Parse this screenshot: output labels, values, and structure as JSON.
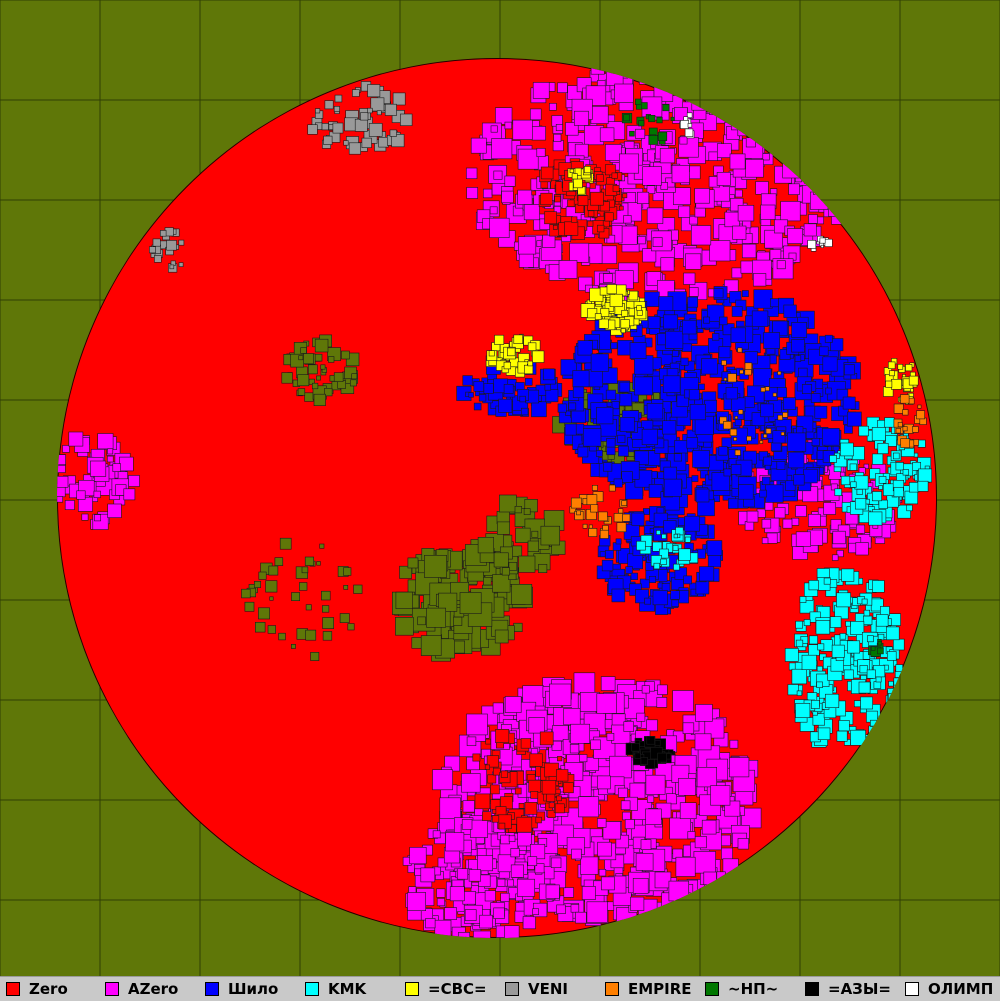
{
  "map": {
    "background": "#5f7708",
    "grid_color": "#2f3f04"
  },
  "legend": [
    {
      "label": "Zero",
      "color": "#ff0000"
    },
    {
      "label": "AZero",
      "color": "#ff00ff"
    },
    {
      "label": "Шило",
      "color": "#0000ff"
    },
    {
      "label": "KMK",
      "color": "#00ffff"
    },
    {
      "label": "=CBC=",
      "color": "#ffff00"
    },
    {
      "label": "VENI",
      "color": "#999999"
    },
    {
      "label": "EMPIRE",
      "color": "#ff7f00"
    },
    {
      "label": "~НП~",
      "color": "#007700"
    },
    {
      "label": "=АЗЫ=",
      "color": "#000000"
    },
    {
      "label": "ОЛИМП",
      "color": "#ffffff"
    }
  ]
}
